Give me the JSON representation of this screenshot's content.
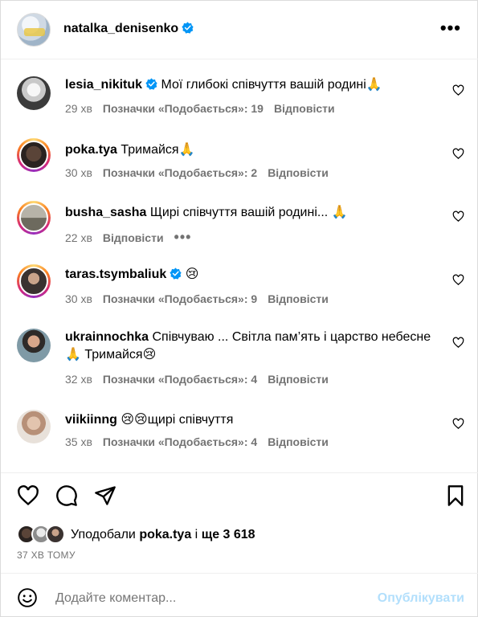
{
  "post": {
    "author": "natalka_denisenko",
    "more": "•••"
  },
  "comments": [
    {
      "user": "lesia_nikituk",
      "verified": true,
      "text": "Мої глибокі співчуття вашій родині🙏",
      "time": "29 хв",
      "likes": "Позначки «Подобається»: 19",
      "reply": "Відповісти"
    },
    {
      "user": "poka.tya",
      "verified": false,
      "text": "Тримайся🙏",
      "time": "30 хв",
      "likes": "Позначки «Подобається»: 2",
      "reply": "Відповісти"
    },
    {
      "user": "busha_sasha",
      "verified": false,
      "text": "Щирі співчуття вашій родині... 🙏",
      "time": "22 хв",
      "likes": "",
      "reply": "Відповісти",
      "more": "•••"
    },
    {
      "user": "taras.tsymbaliuk",
      "verified": true,
      "text": "😢",
      "time": "30 хв",
      "likes": "Позначки «Подобається»: 9",
      "reply": "Відповісти"
    },
    {
      "user": "ukrainnochka",
      "verified": false,
      "text": "Співчуваю ... Світла пам’ять і царство небесне 🙏 Тримайся😢",
      "time": "32 хв",
      "likes": "Позначки «Подобається»: 4",
      "reply": "Відповісти"
    },
    {
      "user": "viikiinng",
      "verified": false,
      "text": "😢😢щирі співчуття",
      "time": "35 хв",
      "likes": "Позначки «Подобається»: 4",
      "reply": "Відповісти"
    }
  ],
  "liked_by": {
    "prefix": "Уподобали ",
    "user": "poka.tya",
    "middle": " і ",
    "rest": "ще 3 618"
  },
  "time_ago": "37 ХВ ТОМУ",
  "add_comment": {
    "placeholder": "Додайте коментар...",
    "publish": "Опублікувати"
  },
  "colors": {
    "verified": "#0095f6",
    "secondary_text": "#737373",
    "publish_disabled": "#b2dffc"
  }
}
